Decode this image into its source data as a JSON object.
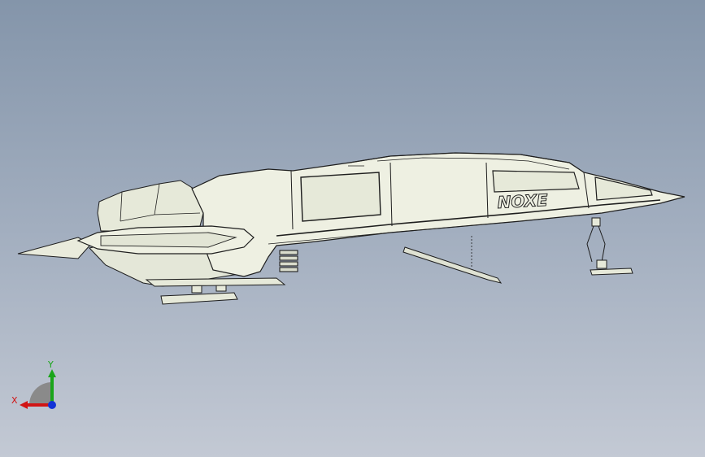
{
  "viewport": {
    "background_top": "#8495aa",
    "background_bottom": "#c3c9d4"
  },
  "model": {
    "fuselage_marking": "NOXE",
    "hull_color": "#eef0e2",
    "line_color": "#1e1e1e"
  },
  "triad": {
    "x_label": "X",
    "y_label": "Y",
    "x_color": "#d11414",
    "y_color": "#1aa51a",
    "z_color": "#1232d6",
    "plane_color": "#8a8a8a"
  }
}
